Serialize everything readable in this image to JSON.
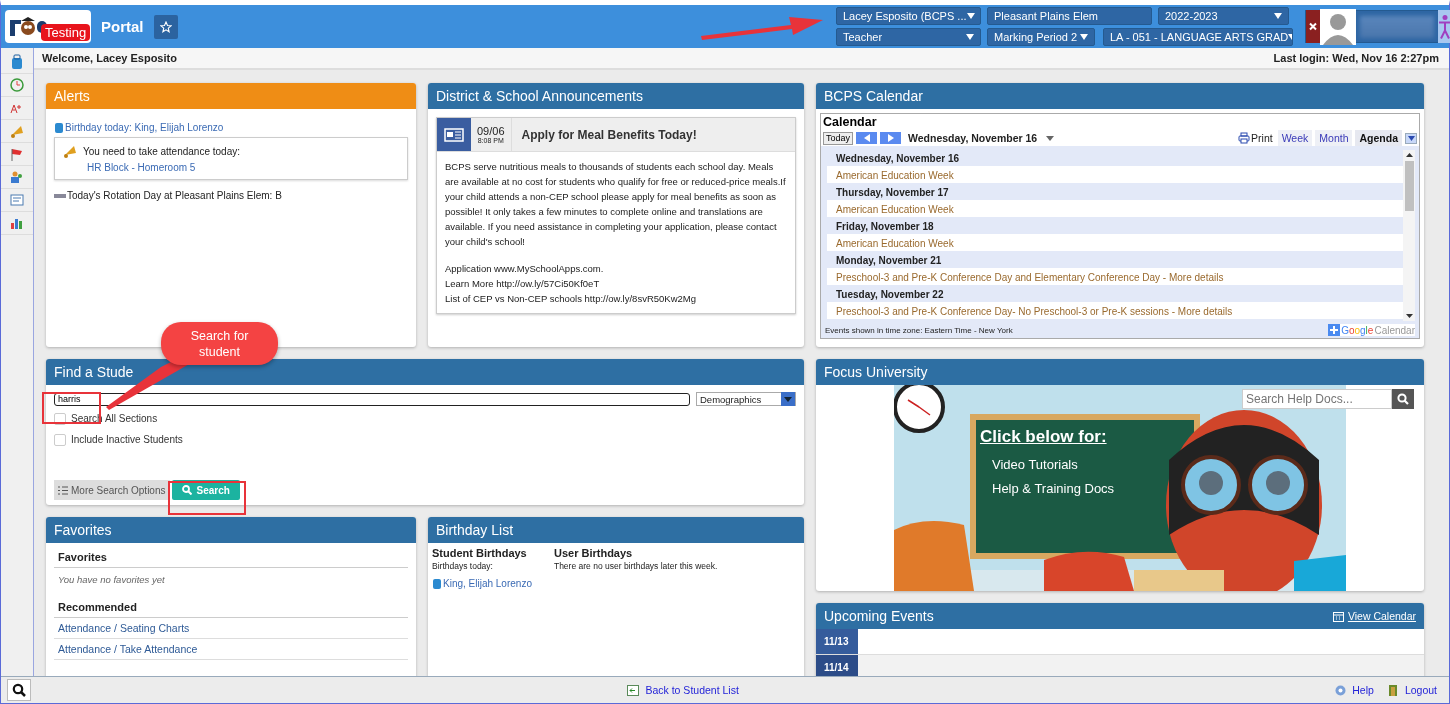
{
  "header": {
    "logo_badge": "Testing",
    "title": "Portal",
    "selectors": [
      {
        "value": "Lacey Esposito (BCPS ...",
        "caret": true
      },
      {
        "value": "Pleasant Plains Elem",
        "caret": false
      },
      {
        "value": "2022-2023",
        "caret": true
      },
      {
        "value": "Teacher",
        "caret": true
      },
      {
        "value": "Marking Period 2",
        "caret": true
      },
      {
        "value": "LA - 051 - LANGUAGE ARTS GRAD",
        "caret": true
      }
    ]
  },
  "welcome": "Welcome, Lacey Esposito",
  "last_login": "Last login: Wed, Nov 16 2:27pm",
  "alerts": {
    "title": "Alerts",
    "birthday": "Birthday today: King, Elijah Lorenzo",
    "attendance_text": "You need to take attendance today:",
    "attendance_link": "HR Block - Homeroom 5",
    "rotation": "Today's Rotation Day at Pleasant Plains Elem: B"
  },
  "announcements": {
    "title": "District & School Announcements",
    "date": "09/06",
    "time": "8:08 PM",
    "heading": "Apply for Meal Benefits Today!",
    "body": "BCPS serve nutritious meals to thousands of students each school day. Meals are available at no cost for students who qualify for free or reduced-price meals.If your child attends a non-CEP school please apply for meal benefits as soon as possible! It only takes a few minutes to complete online and translations are available. If you need assistance in completing your application, please contact your child's school!",
    "lines": [
      "Application  www.MySchoolApps.com.",
      "Learn More  http://ow.ly/57Ci50Kf0eT",
      "List of CEP vs Non-CEP schools  http://ow.ly/8svR50Kw2Mg"
    ]
  },
  "calendar": {
    "title": "BCPS Calendar",
    "heading": "Calendar",
    "today": "Today",
    "date": "Wednesday, November 16",
    "print": "Print",
    "views": [
      {
        "label": "Week",
        "selected": false
      },
      {
        "label": "Month",
        "selected": false
      },
      {
        "label": "Agenda",
        "selected": true
      }
    ],
    "days": [
      {
        "date": "Wednesday, November 16",
        "events": [
          "American Education Week"
        ]
      },
      {
        "date": "Thursday, November 17",
        "events": [
          "American Education Week"
        ]
      },
      {
        "date": "Friday, November 18",
        "events": [
          "American Education Week"
        ]
      },
      {
        "date": "Monday, November 21",
        "events": [
          "Preschool-3 and Pre-K Conference Day and Elementary Conference Day - More details"
        ]
      },
      {
        "date": "Tuesday, November 22",
        "events": [
          "Preschool-3 and Pre-K Conference Day- No Preschool-3 or Pre-K sessions - More details"
        ]
      }
    ],
    "timezone": "Events shown in time zone: Eastern Time - New York",
    "google": "Google",
    "google_suffix": "Calendar"
  },
  "find_student": {
    "title": "Find a Stude",
    "search_value": "harris",
    "select": "Demographics",
    "checkboxes": [
      {
        "label": "Search All Sections",
        "checked": false
      },
      {
        "label": "Include Inactive Students",
        "checked": false
      }
    ],
    "more_button": "More Search Options",
    "search_button": "Search"
  },
  "focus_university": {
    "title": "Focus University",
    "search_placeholder": "Search Help Docs...",
    "banner_heading": "Click below for:",
    "banner_items": [
      "Video Tutorials",
      "Help & Training Docs"
    ]
  },
  "favorites": {
    "title": "Favorites",
    "heading": "Favorites",
    "empty": "You have no favorites yet",
    "recommended": "Recommended",
    "links": [
      "Attendance / Seating Charts",
      "Attendance / Take Attendance"
    ]
  },
  "birthdays": {
    "title": "Birthday List",
    "student_heading": "Student Birthdays",
    "student_sub": "Birthdays today:",
    "student": "King, Elijah Lorenzo",
    "user_heading": "User Birthdays",
    "user_text": "There are no user birthdays later this week."
  },
  "upcoming": {
    "title": "Upcoming Events",
    "link": "View Calendar",
    "dates": [
      "11/13",
      "11/14"
    ]
  },
  "footer": {
    "back": "Back to Student List",
    "help": "Help",
    "logout": "Logout"
  },
  "annotation": {
    "callout": "Search for student"
  }
}
